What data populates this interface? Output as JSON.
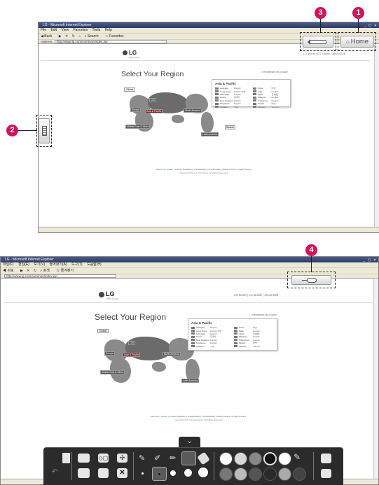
{
  "top_window": {
    "title": "LG - Microsoft Internet Explorer",
    "menu": [
      "File",
      "Edit",
      "View",
      "Favorites",
      "Tools",
      "Help"
    ],
    "toolbar": [
      "Back",
      "Search",
      "Favorites"
    ],
    "address_label": "Address",
    "url": "http://www.lg.com/common/index.jsp"
  },
  "bottom_window": {
    "title": "LG - Microsoft Internet Explorer",
    "menu": [
      "파일(F)",
      "편집(E)",
      "보기(V)",
      "즐겨찾기(A)",
      "도구(T)",
      "도움말(H)"
    ],
    "toolbar": [
      "뒤로",
      "검색",
      "즐겨찾기"
    ],
    "url": "http://www.lg.com/common/index.jsp"
  },
  "lg_page": {
    "logo": "LG",
    "tagline": "Life's Good",
    "top_links": "LG World  |  LG Mobile  |  About B2B",
    "heading": "Select Your Region",
    "global_button": "Global",
    "remember": "Remember My Choice",
    "region_popup_title": "Asia & Pacific",
    "countries_left": [
      {
        "name": "Australia",
        "lang": "English"
      },
      {
        "name": "Hong Kong",
        "lang": "English  中文"
      },
      {
        "name": "Indonesia",
        "lang": "English"
      },
      {
        "name": "Korea",
        "lang": "한국어"
      },
      {
        "name": "New Zealand",
        "lang": "English"
      },
      {
        "name": "Singapore",
        "lang": "English"
      },
      {
        "name": "Thailand",
        "lang": "Thai"
      }
    ],
    "countries_right": [
      {
        "name": "China",
        "lang": "中文"
      },
      {
        "name": "India",
        "lang": "English"
      },
      {
        "name": "Japan",
        "lang": "日本語"
      },
      {
        "name": "Malaysia",
        "lang": "English"
      },
      {
        "name": "Philippines",
        "lang": "English"
      },
      {
        "name": "Taiwan",
        "lang": "中文"
      },
      {
        "name": "Vietnam",
        "lang": "Vietnam"
      }
    ],
    "map_labels": {
      "europe": "Europe",
      "cis": "CIS",
      "asia_pacific": "Asia & Pacific",
      "north_america": "North America",
      "middle_east_africa": "Middle East & Africa",
      "latin_america": "Latin America"
    },
    "search_tag": "Search",
    "footer_links": "About LG | Career | Investor Relations | Sustainability | LG Worldwide | Mobile Version | Legal | Privacy",
    "copyright": "Copyright 2011 LG Electronics. All Rights Reserved."
  },
  "overlay": {
    "home_button": "Home",
    "home_icon": "home-icon",
    "back_icon": "back-arrow-icon",
    "side_icon": "keyboard-icon",
    "mouse_icon": "mouse-icon",
    "badges": [
      "1",
      "2",
      "3",
      "4"
    ],
    "collapse_icon": "chevron-down-icon"
  },
  "drawing_toolbar": {
    "tools_left": [
      "new-page-icon",
      "folder-icon",
      "shapes-icon",
      "move-icon",
      "undo-icon",
      "copy-icon",
      "paste-icon",
      "delete-icon"
    ],
    "pens": [
      "pen-icon",
      "marker-icon",
      "highlighter-icon",
      "fill-icon",
      "eraser-icon"
    ],
    "colors": [
      "#ffffff",
      "#d8d8d8",
      "#888888",
      "#111111",
      "#ffffff",
      "#777777",
      "#bbbbbb",
      "#555555",
      "#2a2a2a",
      "#aaaaaa"
    ],
    "right_tools": [
      "save-icon",
      "print-icon"
    ]
  },
  "colors": {
    "badge": "#d0145a",
    "toolbar_bg": "#2b2b2b",
    "title_bar": "#2e3c66"
  }
}
